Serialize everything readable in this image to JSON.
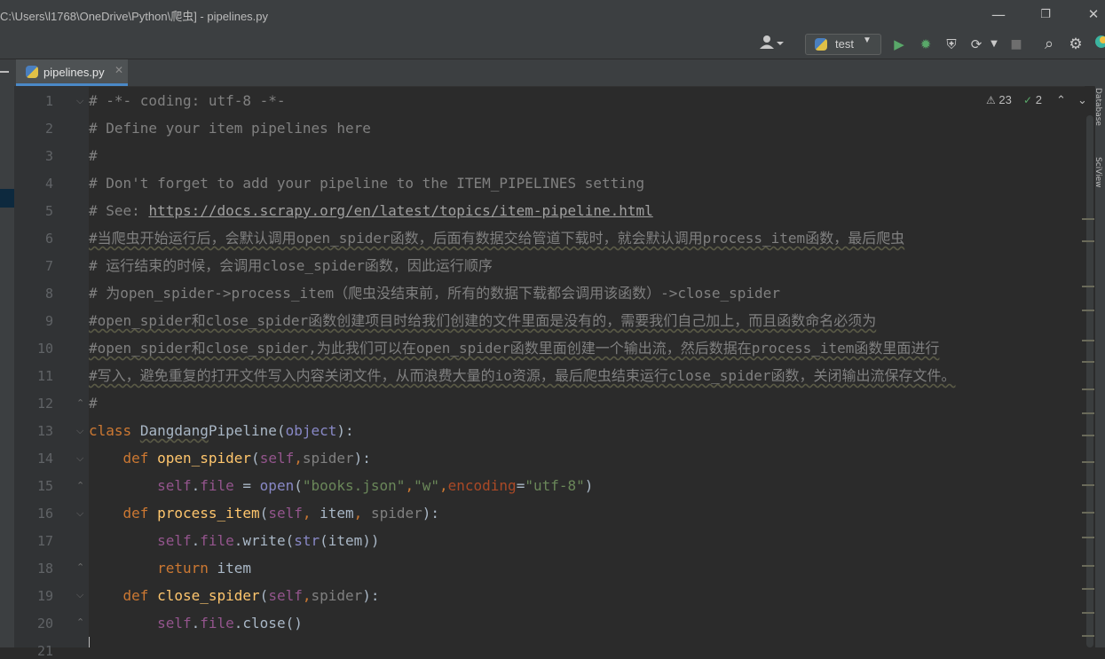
{
  "window": {
    "title": "C:\\Users\\l1768\\OneDrive\\Python\\爬虫] - pipelines.py",
    "minimize": "—",
    "maximize": "❐",
    "close": "✕"
  },
  "toolbar": {
    "user_icon": "user-icon",
    "run_config": "test",
    "run": "▶",
    "debug": "✹",
    "coverage": "⛨",
    "profile": "⟳",
    "stop": "■",
    "search": "⌕",
    "settings": "⚙"
  },
  "tabs": [
    {
      "label": "pipelines.py",
      "close": "✕"
    }
  ],
  "editor": {
    "warnings": "23",
    "weak_warnings": "2",
    "line_numbers": [
      "1",
      "2",
      "3",
      "4",
      "5",
      "6",
      "7",
      "8",
      "9",
      "10",
      "11",
      "12",
      "13",
      "14",
      "15",
      "16",
      "17",
      "18",
      "19",
      "20",
      "21"
    ],
    "lines": [
      "# -*- coding: utf-8 -*-",
      "# Define your item pipelines here",
      "#",
      "# Don't forget to add your pipeline to the ITEM_PIPELINES setting",
      "# See: ",
      "https://docs.scrapy.org/en/latest/topics/item-pipeline.html",
      "#当爬虫开始运行后，会默认调用open_spider函数，后面有数据交给管道下载时，就会默认调用process_item函数，最后爬虫",
      "# 运行结束的时候，会调用close_spider函数，因此运行顺序",
      "# 为open_spider->process_item（爬虫没结束前，所有的数据下载都会调用该函数）->close_spider",
      "#open_spider和close_spider函数创建项目时给我们创建的文件里面是没有的，需要我们自己加上，而且函数命名必须为",
      "#open_spider和close_spider,为此我们可以在open_spider函数里面创建一个输出流，然后数据在process_item函数里面进行",
      "#写入，避免重复的打开文件写入内容关闭文件，从而浪费大量的io资源，最后爬虫结束运行close_spider函数，关闭输出流保存文件。",
      "#"
    ],
    "code": {
      "class_kw": "class",
      "class_name_a": "Dangdang",
      "class_name_b": "Pipeline",
      "obj": "object",
      "def": "def",
      "open_spider": "open_spider",
      "self": "self",
      "spider": "spider",
      "file": "file",
      "open": "open",
      "books_json": "\"books.json\"",
      "w": "\"w\"",
      "encoding": "encoding",
      "utf8": "\"utf-8\"",
      "process_item": "process_item",
      "item": "item",
      "write": "write",
      "str": "str",
      "return": "return",
      "close_spider": "close_spider",
      "close": "close"
    }
  },
  "side_panels": {
    "right_1": "Database",
    "right_2": "SciView"
  }
}
